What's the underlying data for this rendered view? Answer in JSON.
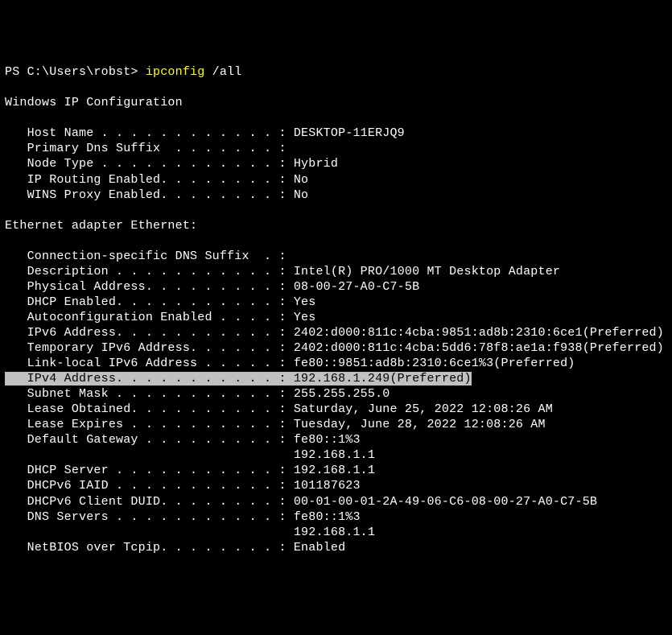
{
  "prompt": "PS C:\\Users\\robst> ",
  "command": "ipconfig",
  "args": " /all",
  "blank": "",
  "section_header": "Windows IP Configuration",
  "config_lines": {
    "host_name": "   Host Name . . . . . . . . . . . . : DESKTOP-11ERJQ9",
    "primary_dns": "   Primary Dns Suffix  . . . . . . . :",
    "node_type": "   Node Type . . . . . . . . . . . . : Hybrid",
    "ip_routing": "   IP Routing Enabled. . . . . . . . : No",
    "wins_proxy": "   WINS Proxy Enabled. . . . . . . . : No"
  },
  "adapter_header": "Ethernet adapter Ethernet:",
  "adapter_lines": {
    "conn_suffix": "   Connection-specific DNS Suffix  . :",
    "description": "   Description . . . . . . . . . . . : Intel(R) PRO/1000 MT Desktop Adapter",
    "physical_addr": "   Physical Address. . . . . . . . . : 08-00-27-A0-C7-5B",
    "dhcp_enabled": "   DHCP Enabled. . . . . . . . . . . : Yes",
    "autoconfig": "   Autoconfiguration Enabled . . . . : Yes",
    "ipv6_addr": "   IPv6 Address. . . . . . . . . . . : 2402:d000:811c:4cba:9851:ad8b:2310:6ce1(Preferred)",
    "temp_ipv6": "   Temporary IPv6 Address. . . . . . : 2402:d000:811c:4cba:5dd6:78f8:ae1a:f938(Preferred)",
    "link_local": "   Link-local IPv6 Address . . . . . : fe80::9851:ad8b:2310:6ce1%3(Preferred)",
    "ipv4_addr": "   IPv4 Address. . . . . . . . . . . : 192.168.1.249(Preferred)",
    "subnet_mask": "   Subnet Mask . . . . . . . . . . . : 255.255.255.0",
    "lease_obtained": "   Lease Obtained. . . . . . . . . . : Saturday, June 25, 2022 12:08:26 AM",
    "lease_expires": "   Lease Expires . . . . . . . . . . : Tuesday, June 28, 2022 12:08:26 AM",
    "default_gw1": "   Default Gateway . . . . . . . . . : fe80::1%3",
    "default_gw2": "                                       192.168.1.1",
    "dhcp_server": "   DHCP Server . . . . . . . . . . . : 192.168.1.1",
    "dhcpv6_iaid": "   DHCPv6 IAID . . . . . . . . . . . : 101187623",
    "dhcpv6_duid": "   DHCPv6 Client DUID. . . . . . . . : 00-01-00-01-2A-49-06-C6-08-00-27-A0-C7-5B",
    "dns_servers1": "   DNS Servers . . . . . . . . . . . : fe80::1%3",
    "dns_servers2": "                                       192.168.1.1",
    "netbios": "   NetBIOS over Tcpip. . . . . . . . : Enabled"
  }
}
